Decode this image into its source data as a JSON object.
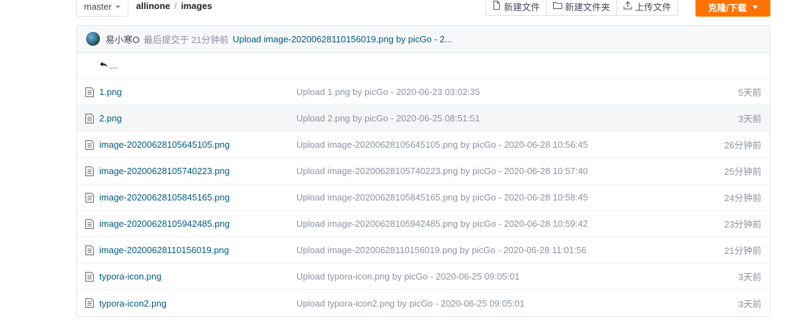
{
  "toolbar": {
    "branch": "master",
    "breadcrumb": {
      "repo": "allinone",
      "separator": "/",
      "folder": "images"
    },
    "new_file": "新建文件",
    "new_folder": "新建文件夹",
    "upload_file": "上传文件",
    "clone_download": "克隆/下载",
    "icons": {
      "new_file": "file-icon",
      "new_folder": "folder-icon",
      "upload": "upload-icon",
      "branch_caret": "chevron-down-icon",
      "clone_caret": "chevron-down-icon"
    },
    "accent_color": "#fe7300"
  },
  "latest_commit": {
    "author": "易小寒O",
    "meta": "最后提交于 21分钟前",
    "message": "Upload image-20200628110156019.png by picGo - 2..."
  },
  "parent_link": {
    "label": "...",
    "icon": "reply-arrow-icon"
  },
  "files": [
    {
      "name": "1.png",
      "commit": "Upload 1.png by picGo - 2020-06-23 03:02:35",
      "time": "5天前"
    },
    {
      "name": "2.png",
      "commit": "Upload 2.png by picGo - 2020-06-25 08:51:51",
      "time": "3天前"
    },
    {
      "name": "image-20200628105645105.png",
      "commit": "Upload image-20200628105645105.png by picGo - 2020-06-28 10:56:45",
      "time": "26分钟前"
    },
    {
      "name": "image-20200628105740223.png",
      "commit": "Upload image-20200628105740223.png by picGo - 2020-06-28 10:57:40",
      "time": "25分钟前"
    },
    {
      "name": "image-20200628105845165.png",
      "commit": "Upload image-20200628105845165.png by picGo - 2020-06-28 10:58:45",
      "time": "24分钟前"
    },
    {
      "name": "image-20200628105942485.png",
      "commit": "Upload image-20200628105942485.png by picGo - 2020-06-28 10:59:42",
      "time": "23分钟前"
    },
    {
      "name": "image-20200628110156019.png",
      "commit": "Upload image-20200628110156019.png by picGo - 2020-06-28 11:01:56",
      "time": "21分钟前"
    },
    {
      "name": "typora-icon.png",
      "commit": "Upload typora-icon.png by picGo - 2020-06-25 09:05:01",
      "time": "3天前"
    },
    {
      "name": "typora-icon2.png",
      "commit": "Upload typora-icon2.png by picGo - 2020-06-25 09:05:01",
      "time": "3天前"
    }
  ]
}
